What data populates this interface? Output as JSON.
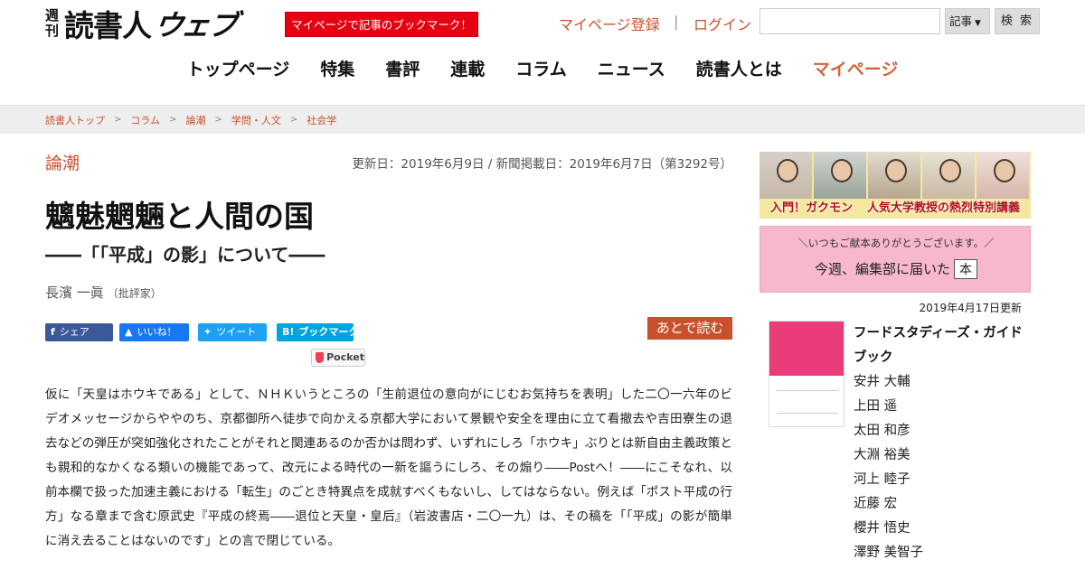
{
  "header": {
    "logo_small_top": "週",
    "logo_small_bottom": "刊",
    "logo_main": "読書人",
    "logo_web": "ウェブ",
    "promo": "マイページで記事のブックマーク！",
    "register": "マイページ登録",
    "separator": "|",
    "login": "ログイン",
    "search_value": "",
    "search_placeholder": "",
    "search_scope": "記事",
    "search_button": "検 索"
  },
  "nav": [
    {
      "label": "トップページ"
    },
    {
      "label": "特集"
    },
    {
      "label": "書評"
    },
    {
      "label": "連載"
    },
    {
      "label": "コラム"
    },
    {
      "label": "ニュース"
    },
    {
      "label": "読書人とは"
    },
    {
      "label": "マイページ"
    }
  ],
  "breadcrumb": [
    "読書人トップ",
    "コラム",
    "論潮",
    "学問・人文",
    "社会学"
  ],
  "article": {
    "category": "論潮",
    "dates": "更新日：2019年6月9日 / 新聞掲載日：2019年6月7日（第3292号）",
    "title": "魑魅魍魎と人間の国",
    "subtitle": "――「「平成」の影」について――",
    "author": "長濱 一眞",
    "author_role": "（批評家）",
    "share": {
      "facebook": "シェア",
      "like": "いいね！",
      "tweet": "ツイート",
      "hatena": "ブックマーク",
      "pocket": "Pocket"
    },
    "read_later": "あとで読む",
    "body": "仮に「天皇はホウキである」として、ＮＨＫいうところの「生前退位の意向がにじむお気持ちを表明」した二〇一六年のビデオメッセージからややのち、京都御所へ徒歩で向かえる京都大学において景観や安全を理由に立て看撤去や吉田寮生の退去などの弾圧が突如強化されたことがそれと関連あるのか否かは問わず、いずれにしろ「ホウキ」ぶりとは新自由主義政策とも親和的なかくなる類いの機能であって、改元による時代の一新を謳うにしろ、その煽り――Postへ！――にこそなれ、以前本欄で扱った加速主義における「転生」のごとき特異点を成就すべくもないし、してはならない。例えば「ポスト平成の行方」なる章まで含む原武史『平成の終焉――退位と天皇・皇后』（岩波書店・二〇一九）は、その稿を「「平成」の影が簡単に消え去ることはないのです」との言で閉じている。"
  },
  "sidebar": {
    "banner1_left": "入門！ガクモン",
    "banner1_right": "人気大学教授の熱烈特別講義",
    "banner2_top": "＼いつもご献本ありがとうございます。／",
    "banner2_main": "今週、編集部に届いた",
    "banner2_book": "本",
    "updated": "2019年4月17日更新",
    "book_title": "フードスタディーズ・ガイドブック",
    "book_authors": [
      "安井 大輔",
      "上田 遥",
      "太田 和彦",
      "大淵 裕美",
      "河上 睦子",
      "近藤 宏",
      "櫻井 悟史",
      "澤野 美智子"
    ]
  },
  "colors": {
    "accent": "#c9502c",
    "promo_red": "#e60012",
    "breadcrumb_bg": "#eeeeee",
    "facebook": "#3b5998",
    "twitter": "#1da1f2",
    "hatena": "#00a4de"
  }
}
